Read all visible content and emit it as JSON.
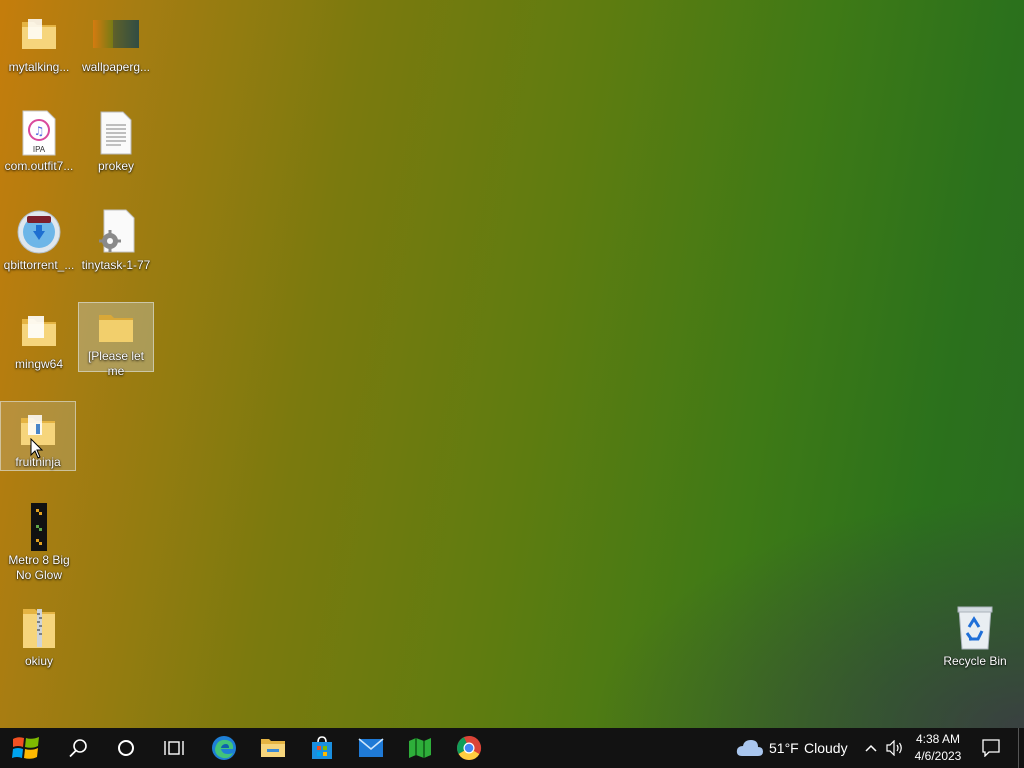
{
  "desktop": {
    "icons": [
      {
        "label": "mytalking..."
      },
      {
        "label": "wallpaperg..."
      },
      {
        "label": "com.outfit7..."
      },
      {
        "label": "prokey"
      },
      {
        "label": "qbittorrent_..."
      },
      {
        "label": "tinytask-1-77"
      },
      {
        "label": "mingw64"
      },
      {
        "label": "[Please let me"
      },
      {
        "label": "fruitninja"
      },
      {
        "label": "Metro 8 Big No Glow"
      },
      {
        "label": "okiuy"
      },
      {
        "label": "Recycle Bin"
      }
    ],
    "ipa_badge": "IPA"
  },
  "taskbar": {
    "weather": {
      "temp": "51°F",
      "condition": "Cloudy"
    },
    "clock": {
      "time": "4:38 AM",
      "date": "4/6/2023"
    }
  },
  "colors": {
    "taskbar": "#121212",
    "accent": "#0078d7"
  }
}
